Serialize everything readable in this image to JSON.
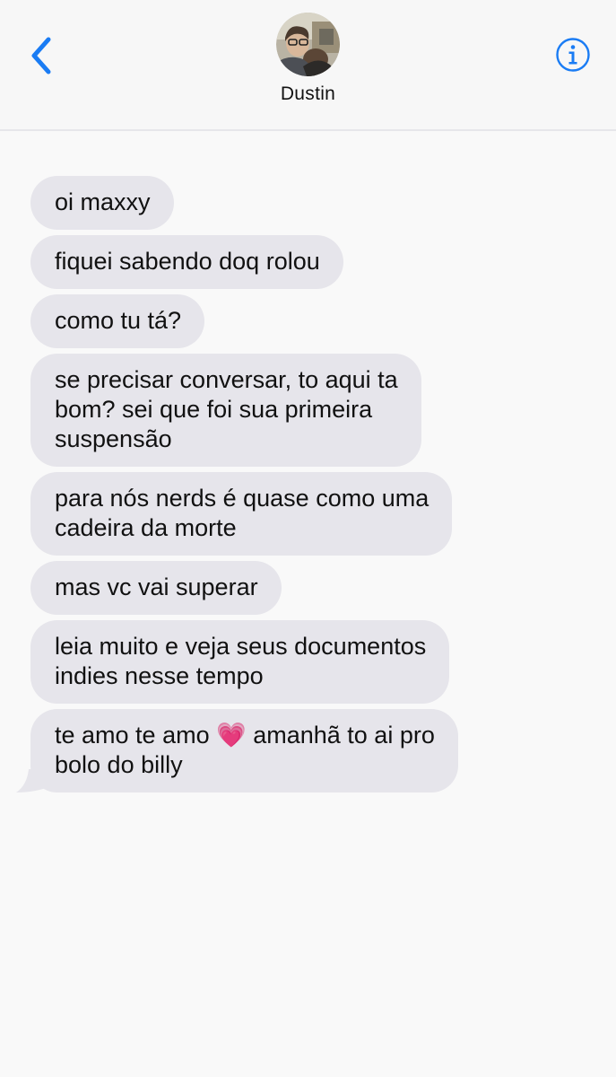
{
  "header": {
    "contact_name": "Dustin",
    "avatar_alt": "Dustin"
  },
  "colors": {
    "accent": "#1a7cf4",
    "received_bubble": "#e6e5eb",
    "background": "#f9f9f9"
  },
  "icons": {
    "back": "chevron-left-icon",
    "info": "info-icon"
  },
  "messages": [
    {
      "lines": [
        "oi maxxy"
      ]
    },
    {
      "lines": [
        "fiquei sabendo doq rolou"
      ]
    },
    {
      "lines": [
        "como tu tá?"
      ]
    },
    {
      "lines": [
        "se precisar conversar, to aqui ta",
        "bom? sei que foi sua primeira",
        "suspensão"
      ]
    },
    {
      "lines": [
        "para nós nerds é quase como uma",
        "cadeira da morte"
      ]
    },
    {
      "lines": [
        "mas vc vai superar"
      ]
    },
    {
      "lines": [
        "leia muito e veja seus documentos",
        "indies nesse tempo"
      ]
    },
    {
      "lines": [
        "te amo te amo 💗 amanhã to ai pro",
        "bolo do billy"
      ]
    }
  ]
}
